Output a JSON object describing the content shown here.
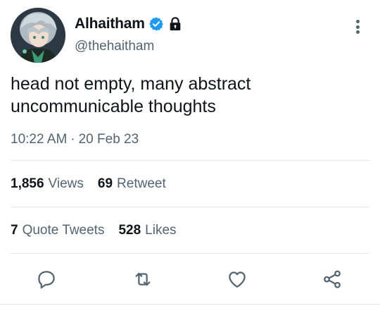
{
  "author": {
    "display_name": "Alhaitham",
    "handle": "@thehaitham",
    "verified": true,
    "protected": true
  },
  "tweet": {
    "text": "head not empty, many abstract\nuncommunicable thoughts",
    "time": "10:22 AM",
    "separator": "·",
    "date": "20 Feb 23"
  },
  "stats": {
    "views": {
      "count": "1,856",
      "label": "Views"
    },
    "retweets": {
      "count": "69",
      "label": "Retweet"
    },
    "quote_tweets": {
      "count": "7",
      "label": "Quote Tweets"
    },
    "likes": {
      "count": "528",
      "label": "Likes"
    }
  },
  "icons": {
    "verified": "verified-badge-icon",
    "lock": "lock-icon",
    "more": "more-vertical-icon",
    "reply": "reply-icon",
    "retweet": "retweet-icon",
    "like": "heart-icon",
    "share": "share-icon"
  },
  "colors": {
    "text_primary": "#0f1419",
    "text_secondary": "#536471",
    "verified_blue": "#1d9bf0",
    "divider": "#e3e7ea"
  }
}
